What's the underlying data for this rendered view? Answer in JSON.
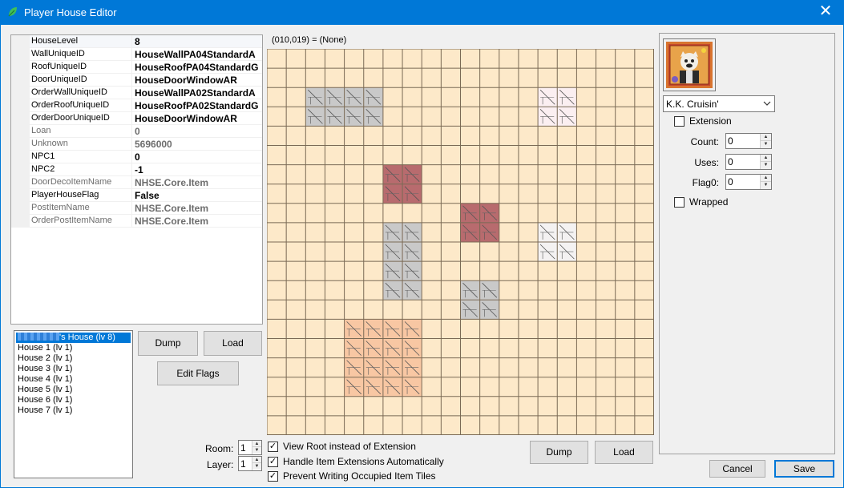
{
  "window": {
    "title": "Player House Editor",
    "close_glyph": "✕"
  },
  "properties": [
    {
      "name": "HouseLevel",
      "value": "8",
      "readonly": false,
      "selected": true
    },
    {
      "name": "WallUniqueID",
      "value": "HouseWallPA04StandardA",
      "readonly": false
    },
    {
      "name": "RoofUniqueID",
      "value": "HouseRoofPA04StandardG",
      "readonly": false
    },
    {
      "name": "DoorUniqueID",
      "value": "HouseDoorWindowAR",
      "readonly": false
    },
    {
      "name": "OrderWallUniqueID",
      "value": "HouseWallPA02StandardA",
      "readonly": false
    },
    {
      "name": "OrderRoofUniqueID",
      "value": "HouseRoofPA02StandardG",
      "readonly": false
    },
    {
      "name": "OrderDoorUniqueID",
      "value": "HouseDoorWindowAR",
      "readonly": false
    },
    {
      "name": "Loan",
      "value": "0",
      "readonly": true
    },
    {
      "name": "Unknown",
      "value": "5696000",
      "readonly": true
    },
    {
      "name": "NPC1",
      "value": "0",
      "readonly": false
    },
    {
      "name": "NPC2",
      "value": "-1",
      "readonly": false
    },
    {
      "name": "DoorDecoItemName",
      "value": "NHSE.Core.Item",
      "readonly": true
    },
    {
      "name": "PlayerHouseFlag",
      "value": "False",
      "readonly": false
    },
    {
      "name": "PostItemName",
      "value": "NHSE.Core.Item",
      "readonly": true
    },
    {
      "name": "OrderPostItemName",
      "value": "NHSE.Core.Item",
      "readonly": true
    }
  ],
  "houses": [
    {
      "label": "'s House (lv 8)",
      "selected": true,
      "redacted_owner": true
    },
    {
      "label": "House 1 (lv 1)"
    },
    {
      "label": "House 2 (lv 1)"
    },
    {
      "label": "House 3 (lv 1)"
    },
    {
      "label": "House 4 (lv 1)"
    },
    {
      "label": "House 5 (lv 1)"
    },
    {
      "label": "House 6 (lv 1)"
    },
    {
      "label": "House 7 (lv 1)"
    }
  ],
  "buttons": {
    "dump_left": "Dump",
    "load_left": "Load",
    "edit_flags": "Edit Flags",
    "dump_right": "Dump",
    "load_right": "Load",
    "cancel": "Cancel",
    "save": "Save"
  },
  "room": {
    "label": "Room:",
    "value": "1"
  },
  "layer": {
    "label": "Layer:",
    "value": "1"
  },
  "grid": {
    "coord_text": "(010,019) = (None)",
    "columns": 20,
    "rows": 20,
    "base_color": "#fde9c9",
    "line_color": "#7a6a55",
    "items": [
      {
        "col": 2,
        "row": 2,
        "w": 4,
        "h": 2,
        "color": "#c9c9c9"
      },
      {
        "col": 14,
        "row": 2,
        "w": 2,
        "h": 2,
        "color": "#fbeff1"
      },
      {
        "col": 6,
        "row": 6,
        "w": 2,
        "h": 2,
        "color": "#b86b6e"
      },
      {
        "col": 10,
        "row": 8,
        "w": 2,
        "h": 2,
        "color": "#b86b6e"
      },
      {
        "col": 6,
        "row": 9,
        "w": 2,
        "h": 4,
        "color": "#c9c9c9"
      },
      {
        "col": 14,
        "row": 9,
        "w": 2,
        "h": 2,
        "color": "#f4f2f2"
      },
      {
        "col": 10,
        "row": 12,
        "w": 2,
        "h": 2,
        "color": "#c9c9c9"
      },
      {
        "col": 4,
        "row": 14,
        "w": 4,
        "h": 4,
        "color": "#f8c7a3"
      }
    ]
  },
  "grid_options": [
    {
      "label": "View Root instead of Extension",
      "checked": true
    },
    {
      "label": "Handle Item Extensions Automatically",
      "checked": true
    },
    {
      "label": "Prevent Writing Occupied Item Tiles",
      "checked": true
    }
  ],
  "item_editor": {
    "item_name": "K.K. Cruisin'",
    "extension": {
      "label": "Extension",
      "checked": false
    },
    "count": {
      "label": "Count:",
      "value": "0"
    },
    "uses": {
      "label": "Uses:",
      "value": "0"
    },
    "flag0": {
      "label": "Flag0:",
      "value": "0"
    },
    "wrapped": {
      "label": "Wrapped",
      "checked": false
    },
    "check_glyph": "✓"
  }
}
